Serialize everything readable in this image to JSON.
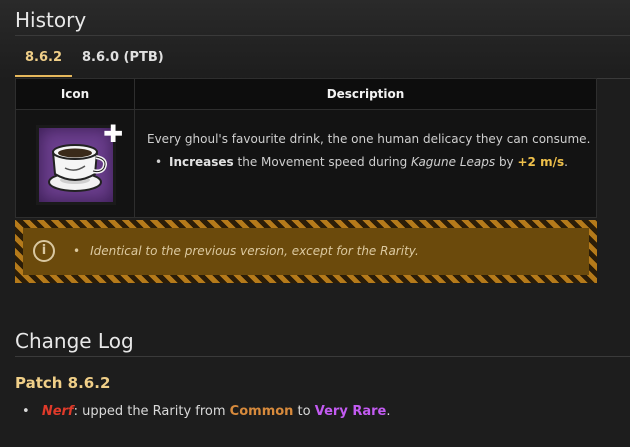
{
  "history": {
    "title": "History"
  },
  "tabs": [
    {
      "label": "8.6.2",
      "active": true
    },
    {
      "label": "8.6.0 (PTB)",
      "active": false
    }
  ],
  "table": {
    "headers": {
      "icon": "Icon",
      "description": "Description"
    },
    "row": {
      "icon": "coffee-cup-perk-icon",
      "intro": "Every ghoul's favourite drink, the one human delicacy they can consume.",
      "bullet": {
        "bold": "Increases",
        "text1": " the Movement speed during ",
        "italic": "Kagune Leaps",
        "text2": " by ",
        "value": "+2 m/s",
        "end": "."
      }
    }
  },
  "notice": {
    "text": "Identical to the previous version, except for the Rarity."
  },
  "changelog": {
    "title": "Change Log",
    "patch": "Patch 8.6.2",
    "entry": {
      "tag": "Nerf",
      "text1": ": upped the Rarity from ",
      "from": "Common",
      "text2": " to ",
      "to": "Very Rare",
      "end": "."
    }
  },
  "colors": {
    "accent": "#f0cf88",
    "rarity_common": "#d78a3c",
    "rarity_very_rare": "#c35bf2",
    "nerf": "#e03a2a",
    "perk_bg": "#6c3f8e"
  }
}
